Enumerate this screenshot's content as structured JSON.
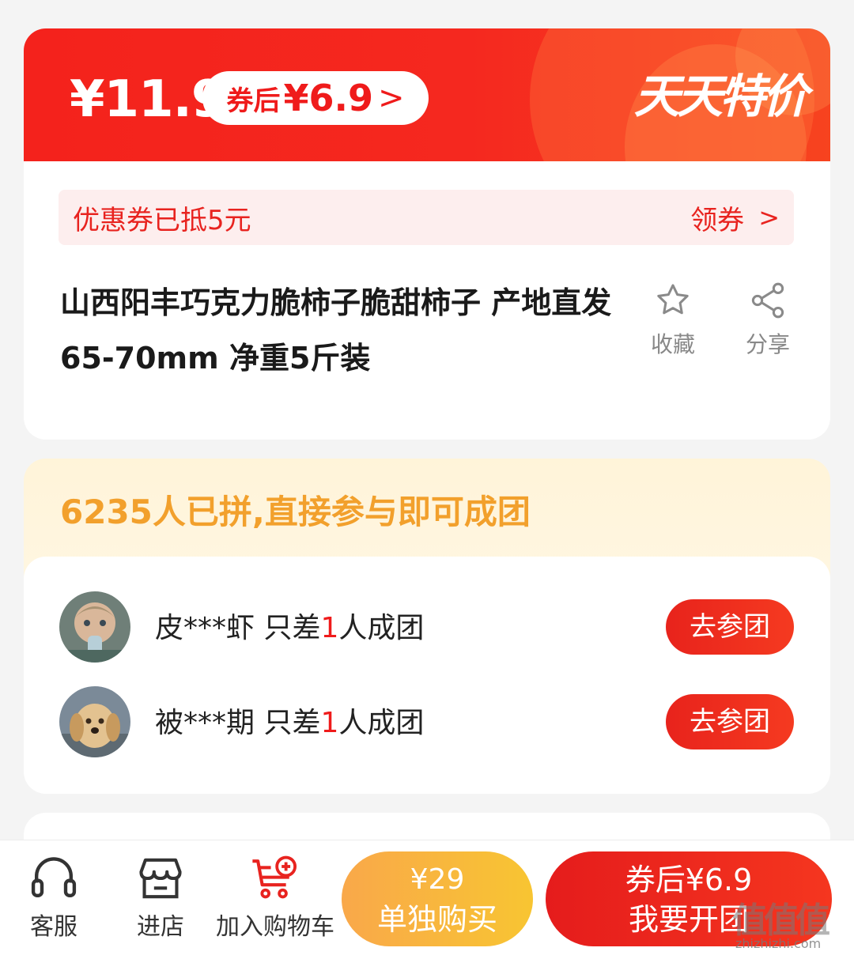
{
  "banner": {
    "price": "¥11.9",
    "coupon_price_label": "券后",
    "coupon_price_value": "¥6.9",
    "brand": "天天特价"
  },
  "coupon": {
    "text": "优惠券已抵5元",
    "claim_label": "领券"
  },
  "product": {
    "title": "山西阳丰巧克力脆柿子脆甜柿子 产地直发 65-70mm 净重5斤装",
    "favorite_label": "收藏",
    "share_label": "分享"
  },
  "group": {
    "header": "6235人已拼,直接参与即可成团",
    "rows": [
      {
        "user": "皮***虾",
        "pre": "只差",
        "count": "1",
        "post": "人成团",
        "button": "去参团"
      },
      {
        "user": "被***期",
        "pre": "只差",
        "count": "1",
        "post": "人成团",
        "button": "去参团"
      }
    ]
  },
  "bottom_bar": {
    "service_label": "客服",
    "store_label": "进店",
    "cart_label": "加入购物车",
    "buy_alone_price": "¥29",
    "buy_alone_label": "单独购买",
    "buy_group_price": "券后¥6.9",
    "buy_group_label": "我要开团"
  },
  "watermark": {
    "text": "值值值",
    "url": "zhizhizhi.com"
  },
  "colors": {
    "accent_red": "#ef1b1b",
    "group_orange": "#f2a02c",
    "buy_alone_yellow": "#f8c532"
  }
}
